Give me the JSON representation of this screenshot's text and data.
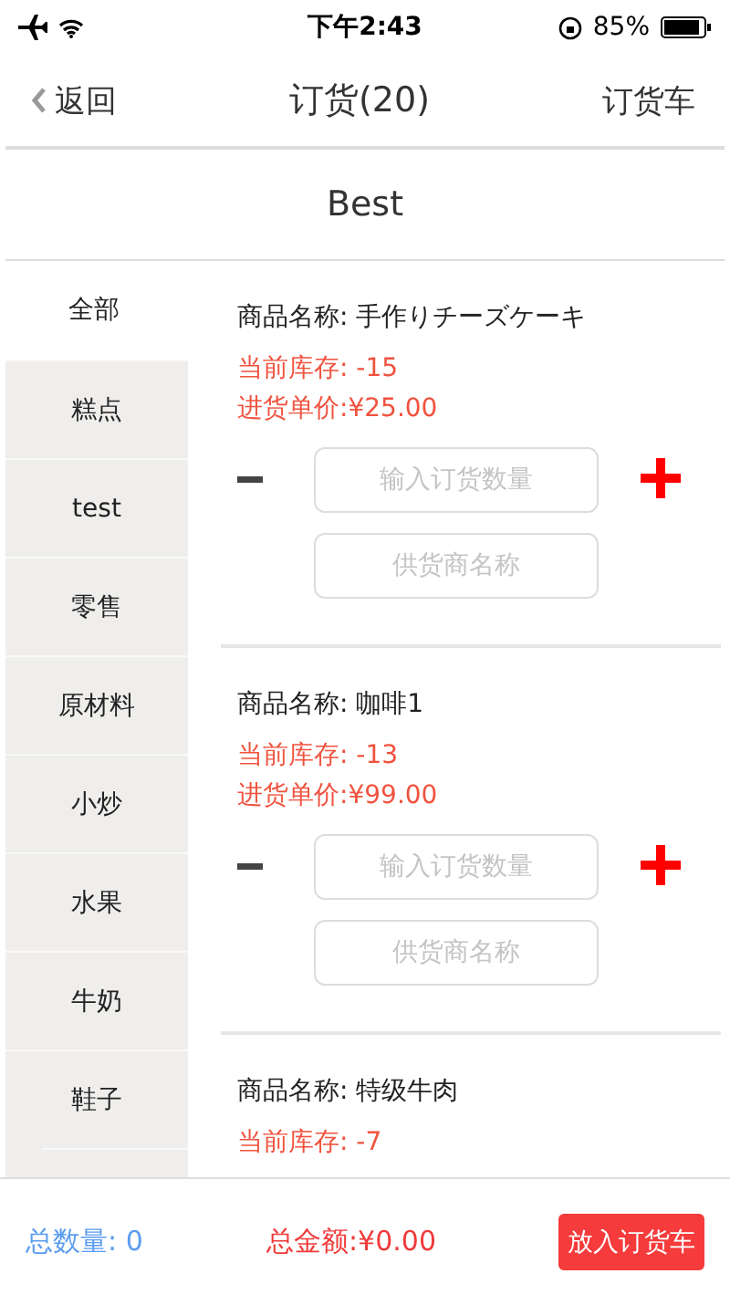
{
  "status_bar": {
    "time": "下午2:43",
    "battery": "85%"
  },
  "nav": {
    "back": "返回",
    "title": "订货(20)",
    "action": "订货车"
  },
  "store": "Best",
  "categories": [
    {
      "label": "全部",
      "selected": true
    },
    {
      "label": "糕点",
      "selected": false
    },
    {
      "label": "test",
      "selected": false
    },
    {
      "label": "零售",
      "selected": false
    },
    {
      "label": "原材料",
      "selected": false
    },
    {
      "label": "小炒",
      "selected": false
    },
    {
      "label": "水果",
      "selected": false
    },
    {
      "label": "牛奶",
      "selected": false
    },
    {
      "label": "鞋子",
      "selected": false
    }
  ],
  "products": [
    {
      "name": "商品名称:  手作りチーズケーキ",
      "stock": "当前库存:  -15",
      "price": "进货单价:¥25.00",
      "quantity_placeholder": "输入订货数量",
      "supplier_placeholder": "供货商名称"
    },
    {
      "name": "商品名称:  咖啡1",
      "stock": "当前库存:  -13",
      "price": "进货单价:¥99.00",
      "quantity_placeholder": "输入订货数量",
      "supplier_placeholder": "供货商名称"
    },
    {
      "name": "商品名称:  特级牛肉",
      "stock": "当前库存:  -7"
    }
  ],
  "footer": {
    "total_quantity": "总数量:  0",
    "total_amount": "总金额:¥0.00",
    "button": "放入订货车"
  }
}
